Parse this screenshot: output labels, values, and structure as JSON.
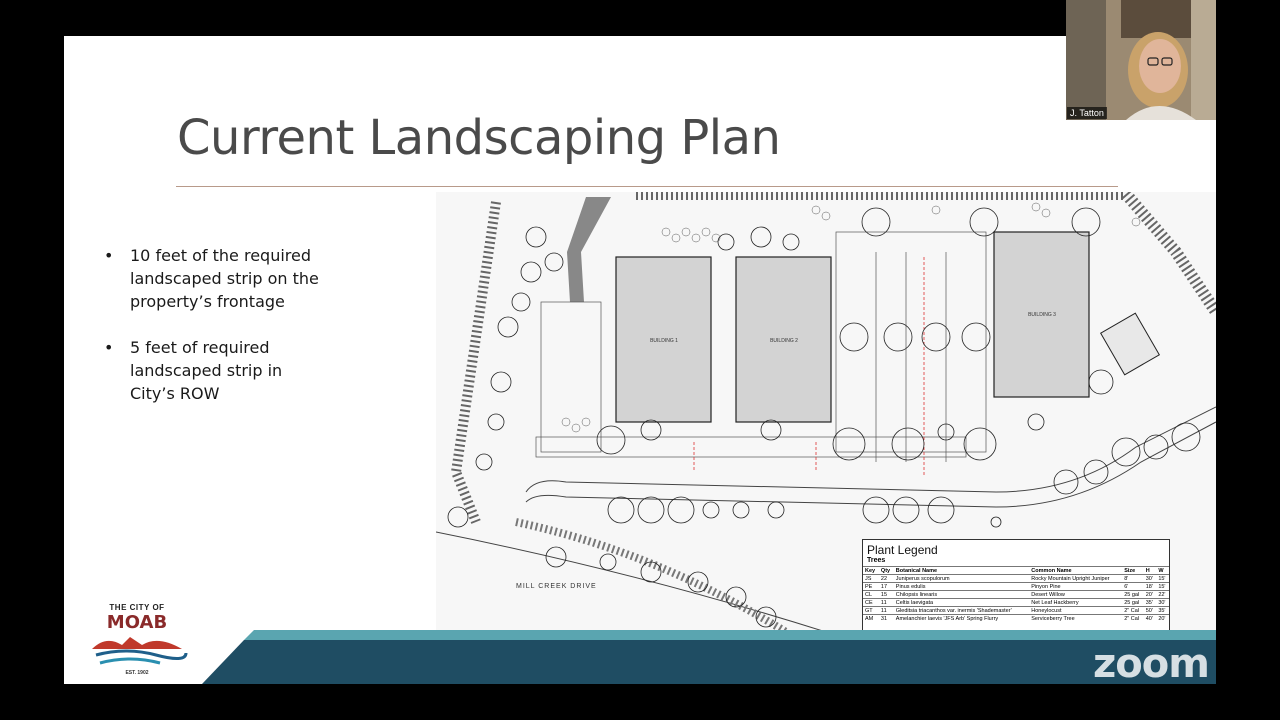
{
  "slide": {
    "title": "Current Landscaping Plan",
    "bullets": [
      "10 feet of the required landscaped strip on the property’s frontage",
      "5 feet of required landscaped strip in City’s ROW"
    ]
  },
  "site_plan": {
    "buildings": [
      "BUILDING 1",
      "BUILDING 2",
      "BUILDING 3"
    ],
    "street_label": "MILL CREEK DRIVE"
  },
  "legend": {
    "title": "Plant Legend",
    "subtitle": "Trees",
    "columns": [
      "Key",
      "Qty",
      "Botanical Name",
      "Common Name",
      "Size",
      "H",
      "W"
    ],
    "rows": [
      [
        "JS",
        "22",
        "Juniperus scopulorum",
        "Rocky Mountain Upright Juniper",
        "8'",
        "30'",
        "15'"
      ],
      [
        "PE",
        "17",
        "Pinus edulis",
        "Pinyon Pine",
        "6'",
        "18'",
        "15'"
      ],
      [
        "CL",
        "15",
        "Chilopsis linearis",
        "Desert Willow",
        "25 gal",
        "20'",
        "22'"
      ],
      [
        "CE",
        "11",
        "Celtis laevigata",
        "Net Leaf Hackberry",
        "25 gal",
        "35'",
        "30'"
      ],
      [
        "GT",
        "11",
        "Gleditsia triacanthos var. inermis 'Shademaster'",
        "Honeylocust",
        "2\" Cal",
        "50'",
        "35'"
      ],
      [
        "AM",
        "31",
        "Amelanchier laevis 'JFS Arb' Spring Flurry",
        "Serviceberry Tree",
        "2\" Cal",
        "40'",
        "20'"
      ]
    ]
  },
  "logo": {
    "top": "THE CITY OF",
    "main": "MOAB",
    "est": "EST. 1902"
  },
  "video": {
    "participant_name": "J. Tatton"
  },
  "watermark": "zoom",
  "colors": {
    "footer_teal": "#1f4d63",
    "footer_light": "#5aa5b0",
    "title_text": "#4a4a4a",
    "rule": "#b89a8a"
  }
}
